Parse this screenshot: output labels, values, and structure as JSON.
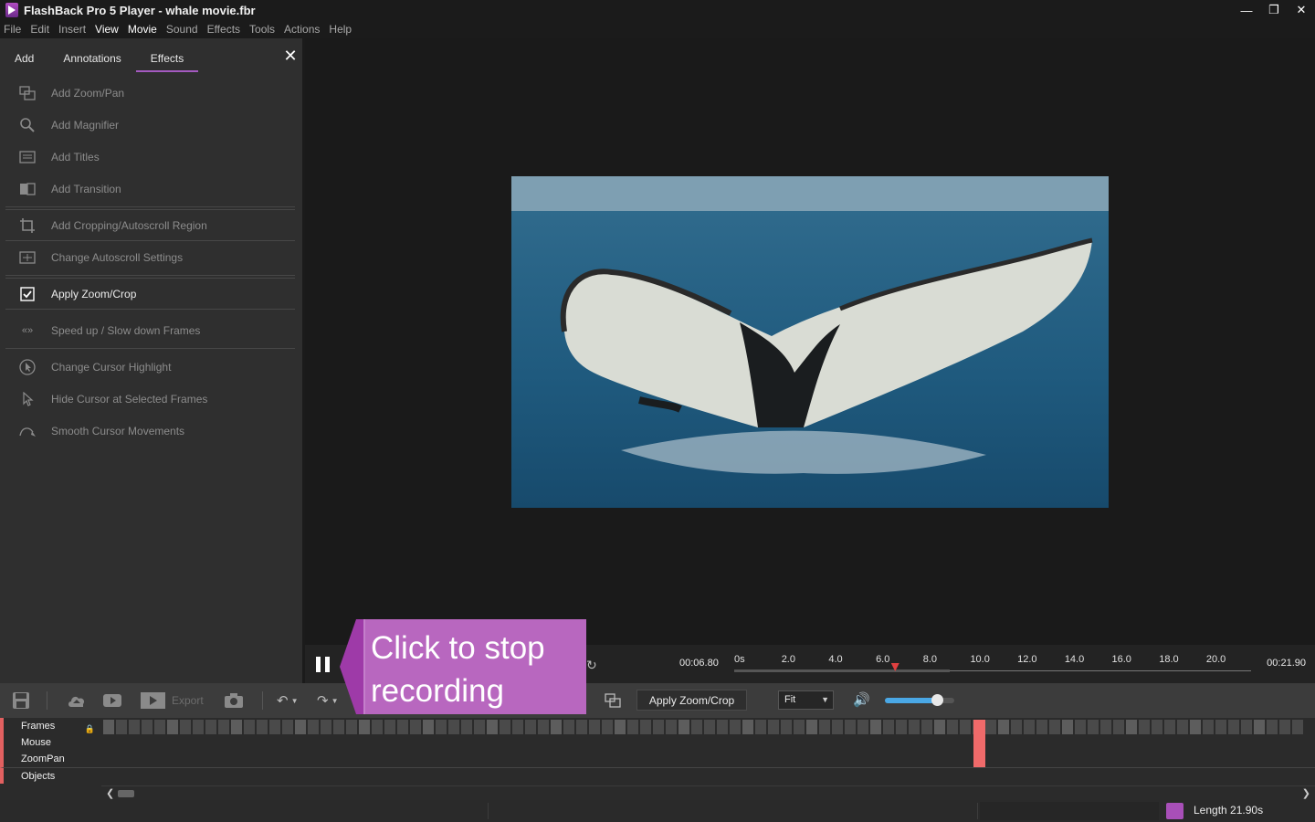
{
  "window": {
    "title": "FlashBack Pro 5 Player - whale movie.fbr",
    "controls": [
      "minimize-icon",
      "restore-icon",
      "close-icon"
    ]
  },
  "menu": [
    "File",
    "Edit",
    "Insert",
    "View",
    "Movie",
    "Sound",
    "Effects",
    "Tools",
    "Actions",
    "Help"
  ],
  "panel": {
    "tabs": [
      "Add",
      "Annotations",
      "Effects"
    ],
    "active_tab": "Effects",
    "effects": [
      {
        "label": "Add Zoom/Pan",
        "icon": "zoom-pan-icon"
      },
      {
        "label": "Add Magnifier",
        "icon": "magnifier-icon"
      },
      {
        "label": "Add Titles",
        "icon": "titles-icon"
      },
      {
        "label": "Add Transition",
        "icon": "transition-icon"
      },
      {
        "label": "Add Cropping/Autoscroll Region",
        "icon": "crop-icon"
      },
      {
        "label": "Change Autoscroll Settings",
        "icon": "autoscroll-icon"
      },
      {
        "label": "Apply Zoom/Crop",
        "icon": "checkbox-checked-icon"
      },
      {
        "label": "Speed up / Slow down Frames",
        "icon": "speed-icon"
      },
      {
        "label": "Change Cursor Highlight",
        "icon": "cursor-highlight-icon"
      },
      {
        "label": "Hide Cursor at Selected Frames",
        "icon": "cursor-icon"
      },
      {
        "label": "Smooth Cursor Movements",
        "icon": "smooth-cursor-icon"
      }
    ]
  },
  "playback": {
    "current_time": "00:06.80",
    "total_time": "00:21.90",
    "ticks": [
      "0s",
      "2.0",
      "4.0",
      "6.0",
      "8.0",
      "10.0",
      "12.0",
      "14.0",
      "16.0",
      "18.0",
      "20.0"
    ],
    "duration_s": 21.9,
    "position_s": 6.8
  },
  "callout": {
    "text": "Click to stop recording"
  },
  "toolbar": {
    "export_label": "Export",
    "apply_label": "Apply Zoom/Crop",
    "zoom_value": "Fit",
    "volume": 0.75
  },
  "timeline": {
    "tracks": [
      "Frames",
      "Mouse",
      "ZoomPan",
      "Objects"
    ]
  },
  "status": {
    "length": "Length 21.90s"
  },
  "colors": {
    "accent": "#a45ac0",
    "callout": "#b867bf",
    "playhead": "#e04040",
    "track_marker": "#f06a6a"
  }
}
